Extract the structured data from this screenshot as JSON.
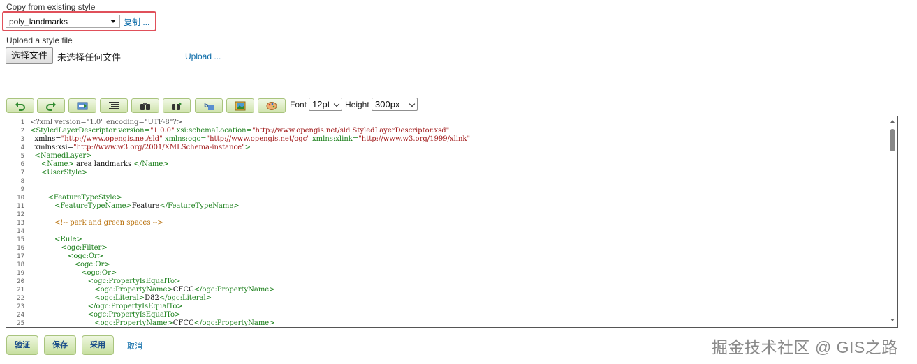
{
  "copy_section": {
    "label": "Copy from existing style",
    "selected_style": "poly_landmarks",
    "copy_link": "复制 ..."
  },
  "upload_section": {
    "label": "Upload a style file",
    "choose_file_button": "选择文件",
    "no_file_text": "未选择任何文件",
    "upload_link": "Upload ..."
  },
  "toolbar": {
    "buttons": [
      {
        "icon": "undo-icon"
      },
      {
        "icon": "redo-icon"
      },
      {
        "icon": "goto-line-icon"
      },
      {
        "icon": "reformat-icon"
      },
      {
        "icon": "find-icon"
      },
      {
        "icon": "find-replace-icon"
      },
      {
        "icon": "syntax-highlight-icon"
      },
      {
        "icon": "image-icon"
      },
      {
        "icon": "color-palette-icon"
      }
    ],
    "font_label": "Font",
    "font_value": "12pt",
    "height_label": "Height",
    "height_value": "300px"
  },
  "editor": {
    "lines": [
      "<?xml version=\"1.0\" encoding=\"UTF-8\"?>",
      "<StyledLayerDescriptor version=\"1.0.0\" xsi:schemaLocation=\"http://www.opengis.net/sld StyledLayerDescriptor.xsd\"",
      "  xmlns=\"http://www.opengis.net/sld\" xmlns:ogc=\"http://www.opengis.net/ogc\" xmlns:xlink=\"http://www.w3.org/1999/xlink\"",
      "  xmlns:xsi=\"http://www.w3.org/2001/XMLSchema-instance\">",
      "  <NamedLayer>",
      "     <Name> area landmarks </Name>",
      "     <UserStyle>",
      "",
      "",
      "        <FeatureTypeStyle>",
      "           <FeatureTypeName>Feature</FeatureTypeName>",
      "",
      "           <!-- park and green spaces -->",
      "",
      "           <Rule>",
      "              <ogc:Filter>",
      "                 <ogc:Or>",
      "                    <ogc:Or>",
      "                       <ogc:Or>",
      "                          <ogc:PropertyIsEqualTo>",
      "                             <ogc:PropertyName>CFCC</ogc:PropertyName>",
      "                             <ogc:Literal>D82</ogc:Literal>",
      "                          </ogc:PropertyIsEqualTo>",
      "                          <ogc:PropertyIsEqualTo>",
      "                             <ogc:PropertyName>CFCC</ogc:PropertyName>"
    ]
  },
  "footer": {
    "validate_button": "验证",
    "save_button": "保存",
    "apply_button": "采用",
    "cancel_link": "取消"
  },
  "watermark": "掘金技术社区 @ GIS之路",
  "colors": {
    "link": "#0b6ba8",
    "highlight_border": "#e0505a",
    "button_green": "#cfe3ad",
    "xml_tag": "#1a7f1a",
    "xml_string": "#a01818",
    "xml_comment": "#b56a00"
  }
}
